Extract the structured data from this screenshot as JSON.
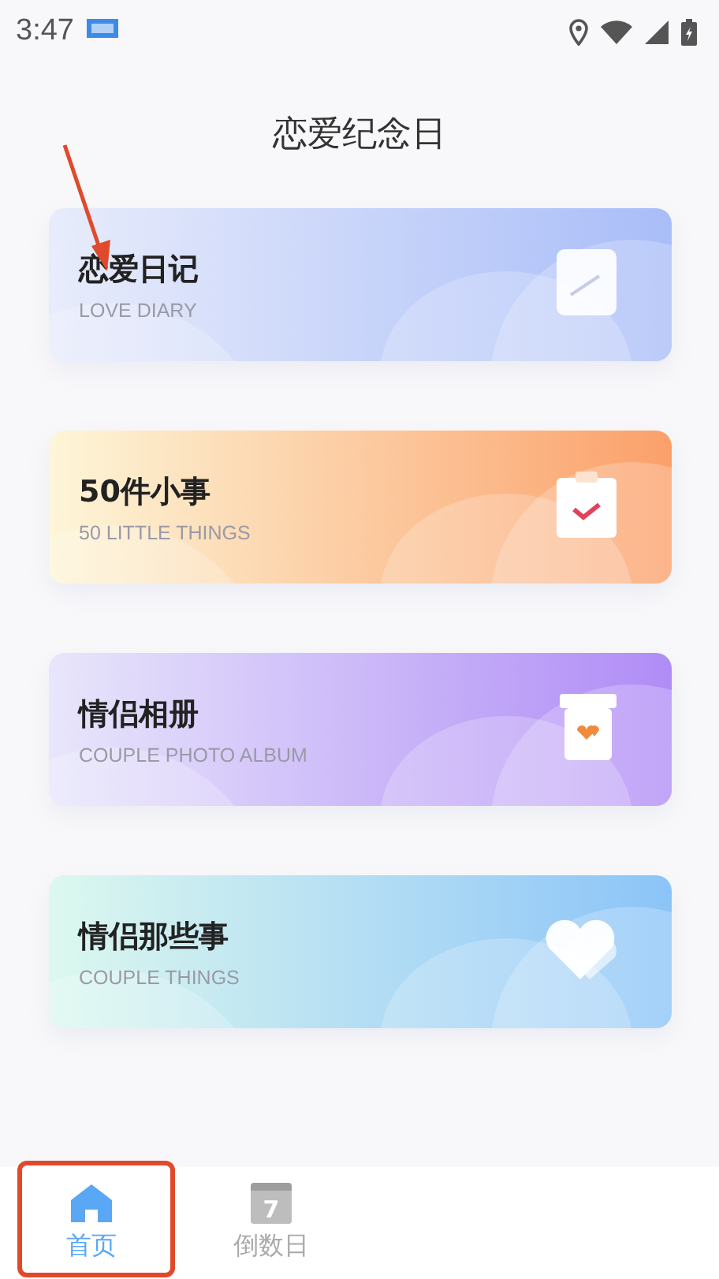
{
  "status_bar": {
    "time": "3:47"
  },
  "title": "恋爱纪念日",
  "cards": [
    {
      "kind": "diary",
      "title": "恋爱日记",
      "subtitle": "LOVE DIARY",
      "color": "#a9bdf8"
    },
    {
      "kind": "checklist",
      "title": "50件小事",
      "subtitle": "50 LITTLE THINGS",
      "color": "#fba06a"
    },
    {
      "kind": "album",
      "title": "情侣相册",
      "subtitle": "COUPLE PHOTO ALBUM",
      "color": "#b08cf6"
    },
    {
      "kind": "hearts",
      "title": "情侣那些事",
      "subtitle": "COUPLE THINGS",
      "color": "#8cc4f8"
    }
  ],
  "tabs": [
    {
      "kind": "home",
      "label": "首页",
      "selected": true
    },
    {
      "kind": "calendar",
      "label": "倒数日",
      "icon_text": "7",
      "selected": false
    }
  ]
}
